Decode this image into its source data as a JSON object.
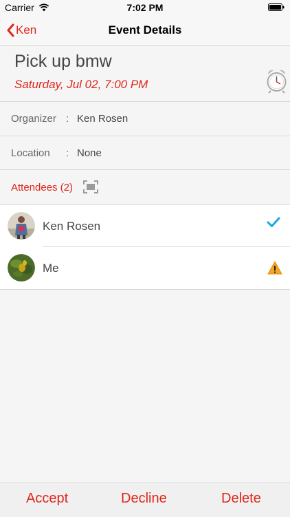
{
  "status_bar": {
    "carrier": "Carrier",
    "time": "7:02 PM"
  },
  "nav": {
    "back_label": "Ken",
    "title": "Event Details"
  },
  "event": {
    "title": "Pick up bmw",
    "date": "Saturday, Jul 02, 7:00 PM"
  },
  "details": {
    "organizer_label": "Organizer",
    "organizer_value": "Ken Rosen",
    "location_label": "Location",
    "location_value": "None",
    "separator": ":"
  },
  "attendees": {
    "label": "Attendees (2)",
    "items": [
      {
        "name": "Ken Rosen",
        "status_icon": "checkmark-icon"
      },
      {
        "name": "Me",
        "status_icon": "warning-icon"
      }
    ]
  },
  "toolbar": {
    "accept_label": "Accept",
    "decline_label": "Decline",
    "delete_label": "Delete"
  },
  "colors": {
    "accent": "#e0251b",
    "check": "#1aa3e8",
    "warning": "#f5a623"
  }
}
